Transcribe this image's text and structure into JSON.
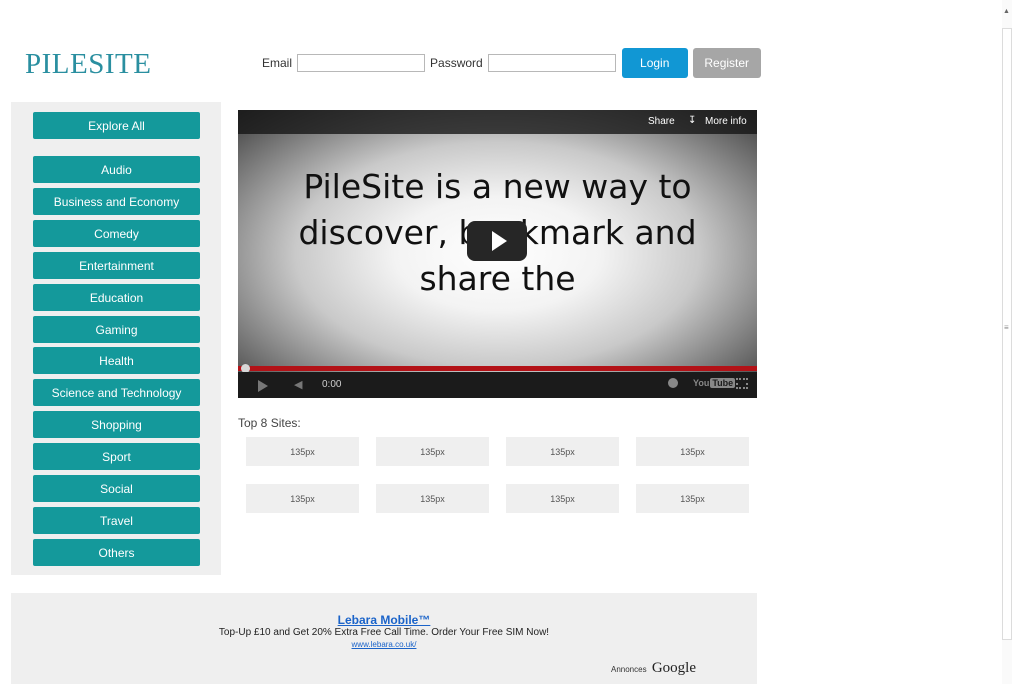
{
  "brand": {
    "logo_text": "PILESITE",
    "accent_color": "#2a8fa0"
  },
  "login": {
    "email_label": "Email",
    "email_value": "",
    "password_label": "Password",
    "password_value": "",
    "login_label": "Login",
    "register_label": "Register"
  },
  "sidebar": {
    "button_color": "#14999b",
    "items": [
      "Explore All",
      "Audio",
      "Business and Economy",
      "Comedy",
      "Entertainment",
      "Education",
      "Gaming",
      "Health",
      "Science and Technology",
      "Shopping",
      "Sport",
      "Social",
      "Travel",
      "Others"
    ]
  },
  "video": {
    "share_label": "Share",
    "more_info_label": "More info",
    "caption_lines": [
      "PileSite is a new way to",
      "discover, bookmark and",
      "share the"
    ],
    "time": "0:00",
    "provider": "YouTube",
    "progress_color": "#b31217"
  },
  "top_sites": {
    "label": "Top 8 Sites:",
    "tiles": [
      "135px",
      "135px",
      "135px",
      "135px",
      "135px",
      "135px",
      "135px",
      "135px"
    ]
  },
  "ad": {
    "title": "Lebara Mobile™",
    "text": "Top-Up £10 and Get 20% Extra Free Call Time. Order Your Free SIM Now!",
    "url": "www.lebara.co.uk/",
    "by_label": "Annonces",
    "by_brand": "Google"
  }
}
